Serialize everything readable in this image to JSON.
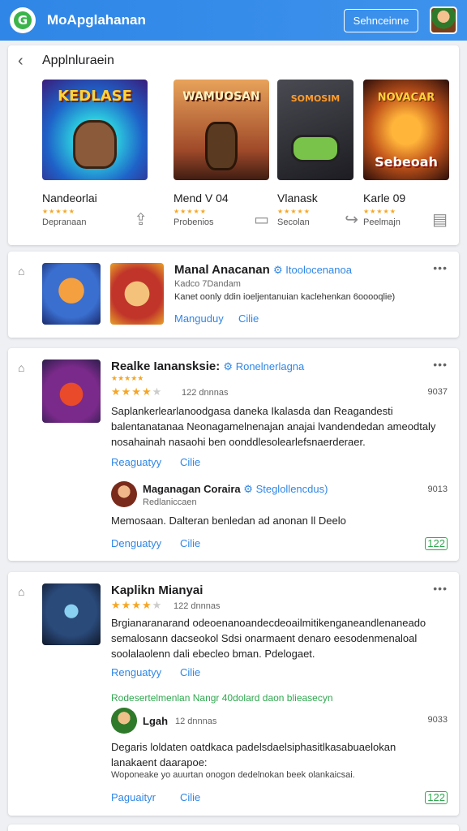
{
  "topbar": {
    "title": "MoApglahanan",
    "search_label": "Sehnceinne"
  },
  "section1": {
    "title": "Applnluraein",
    "games": [
      {
        "art": "KEDLASE",
        "name": "Nandeorlai",
        "stars": "★★★★★",
        "sub": "Depranaan",
        "icon": "share-icon"
      },
      {
        "art": "WAMUOSAN",
        "name": "Mend V 04",
        "stars": "★★★★★",
        "sub": "Probenios",
        "icon": "comment-icon"
      },
      {
        "art": "SOMOSIM",
        "name": "Vlanask",
        "stars": "★★★★★",
        "sub": "Secolan",
        "icon": "forward-icon"
      },
      {
        "art": "Sebeoah",
        "name": "Karle 09",
        "stars": "★★★★★",
        "sub": "Peelmajn",
        "icon": "bookmark-icon"
      }
    ]
  },
  "post1": {
    "title": "Manal Anacanan",
    "tag": "Itoolocenanoa",
    "meta": "Kadco 7Dandam",
    "body": "Kanet oonly ddin ioeljentanuian kaclehenkan 6ooooqlie)",
    "action_reply": "Manguduy",
    "action_like": "Cilie"
  },
  "post2": {
    "title": "Realke Ianansksie:",
    "tag": "Ronelnerlagna",
    "small_stars": "★★★★★",
    "stars": "★★★★",
    "stars_dim": "★",
    "meta": "122 dnnnas",
    "count": "9037",
    "body": "Saplankerlearlanoodgasa daneka Ikalasda dan Reagandesti balentanatanaa Neonagamelnenajan anajai lvandendedan ameodtaly nosahainah nasaohi ben oonddlesolearlefsnaerderaer.",
    "action_reply": "Reaguatyy",
    "action_like": "Cilie",
    "reply": {
      "name": "Maganagan Coraira",
      "tag": "Steglollencdus)",
      "meta": "Redlaniccaen",
      "body": "Memosaan. Dalteran benledan ad anonan ll Deelo",
      "count": "9013",
      "action_reply": "Denguatyy",
      "action_like": "Cilie",
      "badge": "122"
    }
  },
  "post3": {
    "title": "Kaplikn Mianyai",
    "stars": "★★★★",
    "stars_dim": "★",
    "meta": "122 dnnnas",
    "body": "Brgianaranarand odeoenanoandecdeoailmitikenganeandlenaneado semalosann dacseokol Sdsi onarmaent denaro eesodenmenaloal soolalaolenn dali ebecleo bman. Pdelogaet.",
    "action_reply": "Renguatyy",
    "action_like": "Cilie",
    "green_line": "Rodesertelmenlan Nangr 40dolard daon blieasecyn",
    "reply": {
      "name": "Lgah",
      "meta": "12 dnnnas",
      "count": "9033",
      "body": "Degaris loldaten oatdkaca padelsdaelsiphasitlkasabuaelokan lanakaent daarapoe:",
      "body2": "Woponeake yo auurtan onogon dedelnokan beek olankaicsai.",
      "action_reply": "Paguaityr",
      "action_like": "Cilie",
      "badge": "122"
    }
  }
}
